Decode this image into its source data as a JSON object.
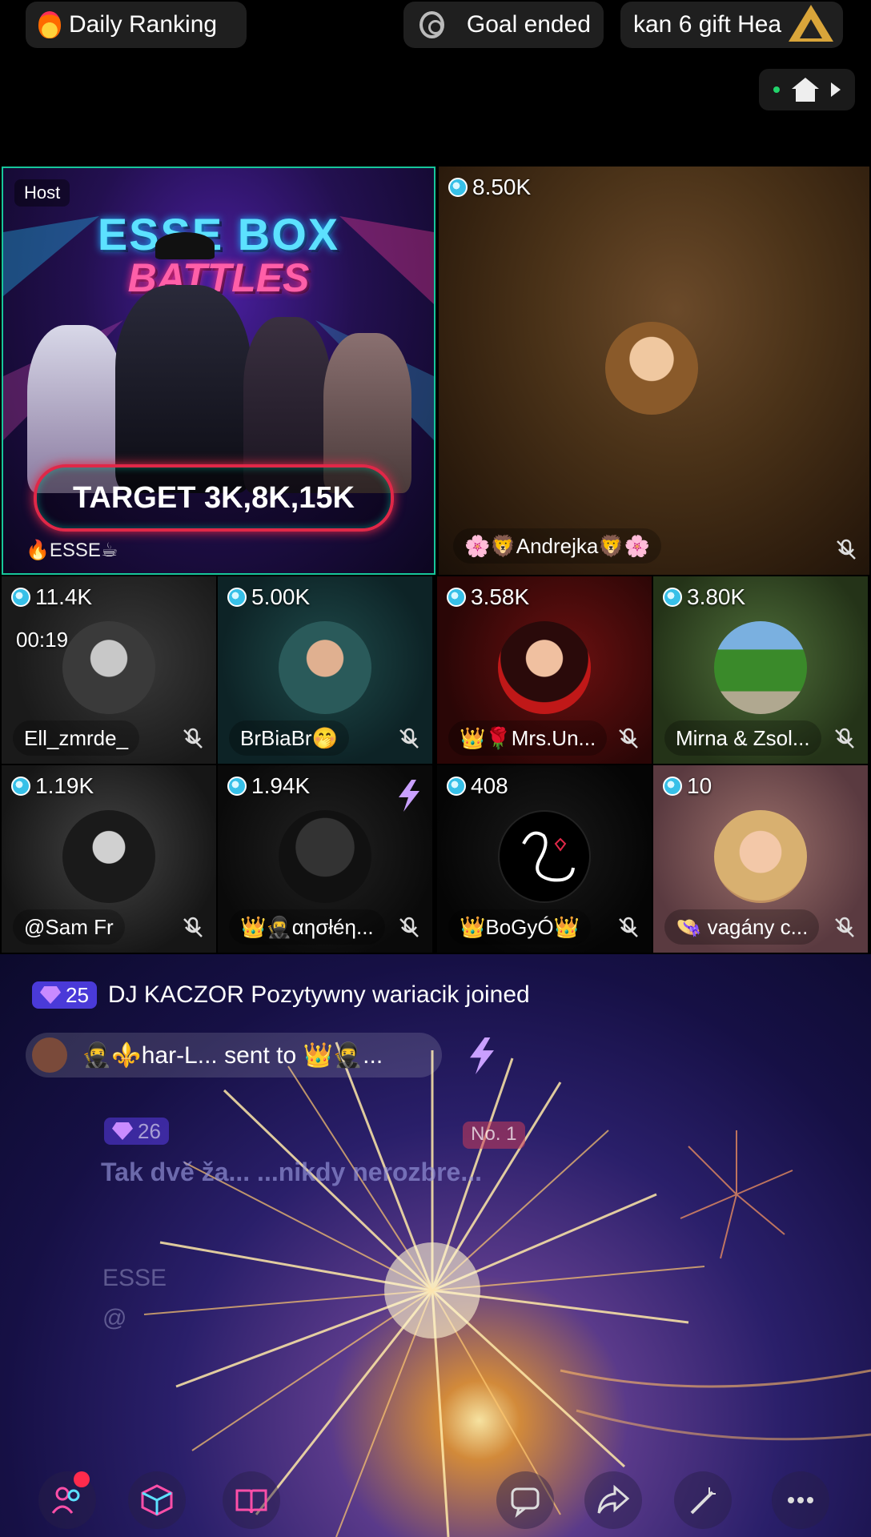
{
  "top_bar": {
    "ranking_label": "Daily Ranking",
    "goal_label": "Goal ended",
    "gift_ticker": "kan 6 gift Hea"
  },
  "host": {
    "tag": "Host",
    "poster_title": "ESSE BOX",
    "poster_subtitle": "BATTLES",
    "target_text": "TARGET 3K,8K,15K",
    "owner_name": "ESSE"
  },
  "guests": [
    {
      "coins": "8.50K",
      "name": "🌸🦁Andrejka🦁🌸"
    },
    {
      "coins": "11.4K",
      "name": "Ell_zmrde_",
      "timer": "00:19"
    },
    {
      "coins": "5.00K",
      "name": "BrBiaBr🤭"
    },
    {
      "coins": "3.58K",
      "name": "👑🌹Mrs.Un..."
    },
    {
      "coins": "3.80K",
      "name": "Mirna & Zsol..."
    },
    {
      "coins": "1.19K",
      "name": "@Sam Fr"
    },
    {
      "coins": "1.94K",
      "name": "👑🥷αησłéη..."
    },
    {
      "coins": "408",
      "name": "👑BoGyÓ👑"
    },
    {
      "coins": "10",
      "name": "👒 vagány c..."
    }
  ],
  "feed": {
    "joined_badge": "25",
    "joined_text": "DJ KACZOR Pozytywny wariacik joined",
    "sent_text": "🥷⚜️har-L... sent to 👑🥷...",
    "chat_badge": "26",
    "chat_rank": "No. 1",
    "chat_message": "Tak dvě ža...                  ...nikdy nerozbre...",
    "faded_name_1": "ESSE",
    "faded_name_2": "@"
  },
  "toolbar": {
    "icons": [
      "multi-guest-icon",
      "box-icon",
      "book-icon",
      "chat-icon",
      "share-icon",
      "magic-wand-icon",
      "more-icon"
    ]
  },
  "colors": {
    "host_border": "#17c69a",
    "target_ring": "#e02848",
    "coin": "#37c0e8",
    "gem_badge": "#4a3ad8",
    "notification": "#ff2b4c"
  }
}
